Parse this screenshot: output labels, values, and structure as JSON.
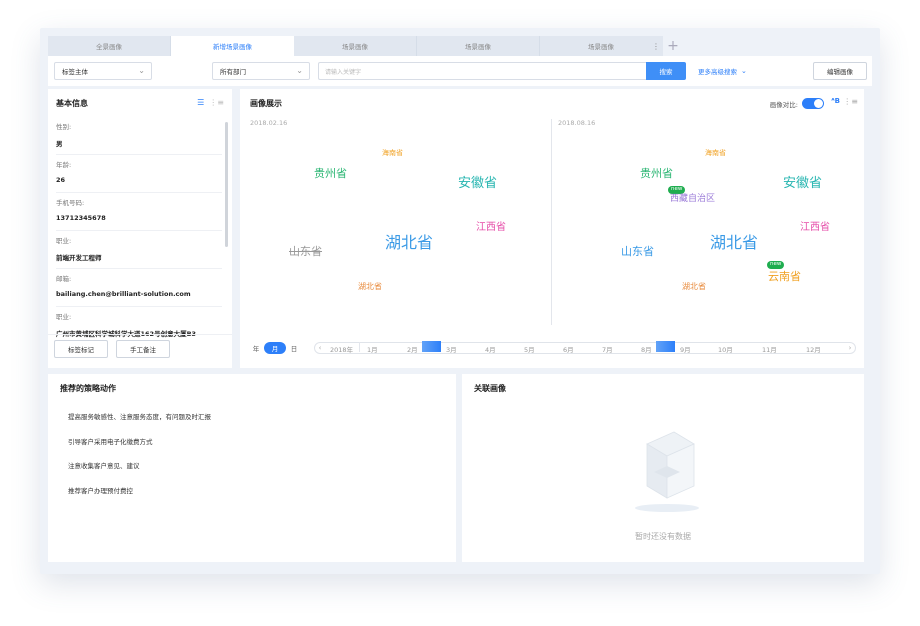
{
  "tabs": [
    {
      "label": "全景画像",
      "active": false
    },
    {
      "label": "新增场景画像",
      "active": true
    },
    {
      "label": "场景画像",
      "active": false
    },
    {
      "label": "场景画像",
      "active": false
    },
    {
      "label": "场景画像",
      "active": false
    }
  ],
  "toolbar": {
    "subject_select": "标签主体",
    "dept_select": "所有部门",
    "search_placeholder": "请输入关键字",
    "search_button": "搜索",
    "advanced_search": "更多高级搜索",
    "edit_button": "编辑画像"
  },
  "basic_info": {
    "title": "基本信息",
    "fields": [
      {
        "label": "性别:",
        "value": "男"
      },
      {
        "label": "年龄:",
        "value": "26"
      },
      {
        "label": "手机号码:",
        "value": "13712345678"
      },
      {
        "label": "职业:",
        "value": "前端开发工程师"
      },
      {
        "label": "邮箱:",
        "value": "bailiang.chen@brilliant-solution.com"
      },
      {
        "label": "职业:",
        "value": "广州市黄埔区科学城科学大道162号创意大厦B3"
      }
    ],
    "tag_button": "标签标记",
    "note_button": "手工备注"
  },
  "portrait": {
    "title": "画像展示",
    "compare_label": "画像对比:",
    "date_left": "2018.02.16",
    "date_right": "2018.08.16",
    "left_words": [
      "海南省",
      "贵州省",
      "安徽省",
      "江西省",
      "山东省",
      "湖北省",
      "湖北省"
    ],
    "right_words": [
      "海南省",
      "贵州省",
      "西藏自治区",
      "安徽省",
      "江西省",
      "山东省",
      "湖北省",
      "云南省",
      "湖北省"
    ],
    "new_badge": "new",
    "colors": {
      "orange": "#f0a020",
      "green": "#2bb673",
      "teal": "#26b5b0",
      "pink": "#e64ba8",
      "blue": "#3a9ae6",
      "purple": "#9b7bd8",
      "gray": "#999999"
    }
  },
  "timeline": {
    "units": [
      "年",
      "月",
      "日"
    ],
    "active_unit": "月",
    "year": "2018年",
    "months": [
      "1月",
      "2月",
      "3月",
      "4月",
      "5月",
      "6月",
      "7月",
      "8月",
      "9月",
      "10月",
      "11月",
      "12月"
    ]
  },
  "actions": {
    "title": "推荐的策略动作",
    "items": [
      "提高服务敏感性、注意服务态度，有问题及时汇报",
      "引导客户采用电子化缴费方式",
      "注意收集客户意见、建议",
      "推荐客户办理预付费控"
    ]
  },
  "related": {
    "title": "关联画像",
    "empty_text": "暂时还没有数据"
  }
}
